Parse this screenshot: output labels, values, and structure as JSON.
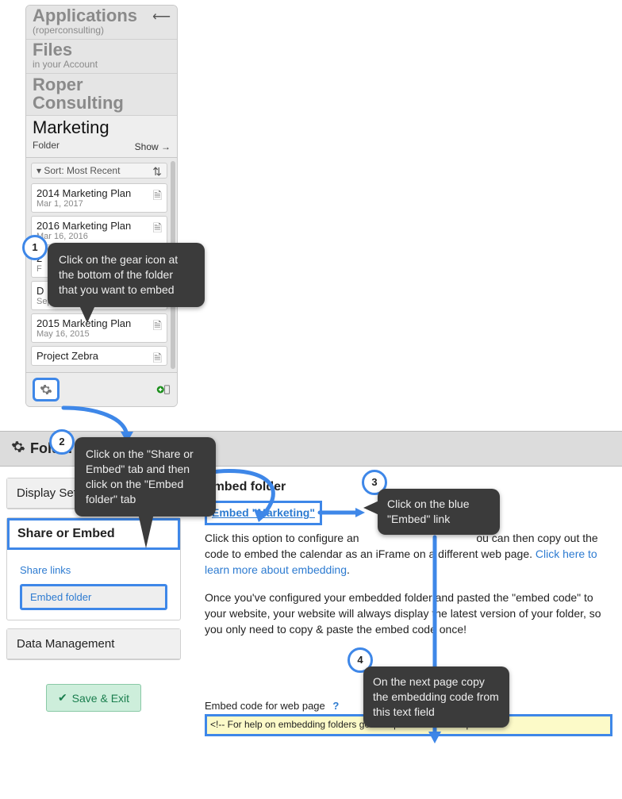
{
  "crumbs": {
    "apps": {
      "title": "Applications",
      "sub": "(roperconsulting)"
    },
    "files": {
      "title": "Files",
      "sub": "in your Account"
    },
    "roper": {
      "title": "Roper Consulting"
    },
    "current": {
      "title": "Marketing",
      "sub": "Folder",
      "show": "Show →"
    },
    "back": "⟵"
  },
  "sort": {
    "label": "Sort: Most Recent",
    "arrow": "▾"
  },
  "items": [
    {
      "title": "2014 Marketing Plan",
      "date": "Mar 1, 2017"
    },
    {
      "title": "2016 Marketing Plan",
      "date": "Mar 16, 2016"
    },
    {
      "title": "2",
      "date": "F"
    },
    {
      "title": "D",
      "date": "Sep 12, 2015"
    },
    {
      "title": "2015 Marketing Plan",
      "date": "May 16, 2015"
    },
    {
      "title": "Project Zebra",
      "date": ""
    }
  ],
  "strip": "Folder Settings",
  "left": {
    "display": "Display Settings",
    "share": "Share or Embed",
    "share_links": "Share links",
    "embed_folder": "Embed folder",
    "data": "Data Management"
  },
  "right": {
    "title": "Embed folder",
    "link_label": "Embed \"Marketing\"",
    "body_a": "Click this option to configure an",
    "body_b": "ou can then copy out the code to embed the calendar as an iFrame on a different web page. ",
    "learn": "Click here to learn more about embedding",
    "period": ".",
    "body2": "Once you've configured your embedded folder and pasted the \"embed code\" to your website, your website will always display the latest version of your folder, so you only need to copy & paste the embed code once!",
    "code_label": "Embed code for web page",
    "help": "?",
    "code_value": "<!-- For help on embedding folders go to http://developer.keep"
  },
  "save": "Save & Exit",
  "callouts": {
    "c1": {
      "num": "1",
      "text": "Click on the gear icon at the bottom of the folder that you want to embed"
    },
    "c2": {
      "num": "2",
      "text": "Click on the \"Share or Embed\" tab and then click on the \"Embed folder\" tab"
    },
    "c3": {
      "num": "3",
      "text": "Click on the blue \"Embed\" link"
    },
    "c4": {
      "num": "4",
      "text": "On the next page copy the embedding code from this text field"
    }
  }
}
